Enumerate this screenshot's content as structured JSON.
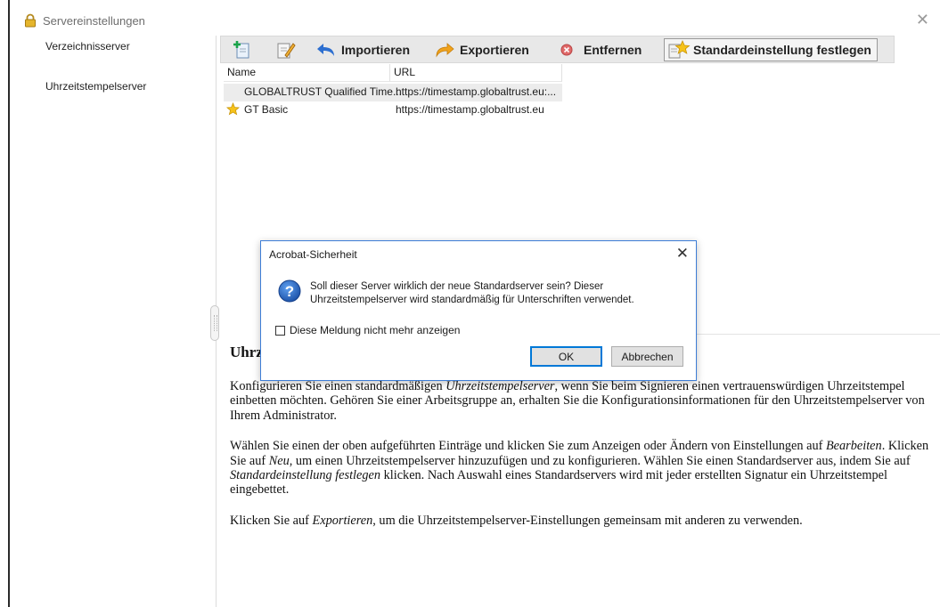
{
  "window": {
    "title": "Servereinstellungen",
    "lock_icon": "lock-icon",
    "close_icon": "close-icon"
  },
  "sidebar": {
    "items": [
      {
        "label": "Verzeichnisserver"
      },
      {
        "label": "Uhrzeitstempelserver"
      }
    ]
  },
  "toolbar": {
    "new_icon": "add-server-icon",
    "edit_icon": "edit-icon",
    "import_label": "Importieren",
    "export_label": "Exportieren",
    "remove_label": "Entfernen",
    "set_default_label": "Standardeinstellung festlegen"
  },
  "table": {
    "columns": [
      "Name",
      "URL"
    ],
    "rows": [
      {
        "name": "GLOBALTRUST Qualified Time...",
        "url": "https://timestamp.globaltrust.eu:...",
        "default": false,
        "selected": true
      },
      {
        "name": "GT Basic",
        "url": "https://timestamp.globaltrust.eu",
        "default": true,
        "selected": false
      }
    ]
  },
  "help": {
    "heading": "Uhrz",
    "p1_a": "Konfigurieren Sie einen standardmäßigen ",
    "p1_em": "Uhrzeitstempelserver",
    "p1_b": ", wenn Sie beim Signieren einen vertrauenswürdigen Uhrzeitstempel einbetten möchten. Gehören Sie einer Arbeitsgruppe an, erhalten Sie die Konfigurationsinformationen für den Uhrzeitstempelserver von Ihrem Administrator.",
    "p2_a": "Wählen Sie einen der oben aufgeführten Einträge und klicken Sie zum Anzeigen oder Ändern von Einstellungen auf ",
    "p2_em1": "Bearbeiten",
    "p2_b": ". Klicken Sie auf ",
    "p2_em2": "Neu",
    "p2_c": ", um einen Uhrzeitstempelserver hinzuzufügen und zu konfigurieren. Wählen Sie einen Standardserver aus, indem Sie auf ",
    "p2_em3": "Standardeinstellung festlegen",
    "p2_d": " klicken. Nach Auswahl eines Standardservers wird mit jeder erstellten Signatur ein Uhrzeitstempel eingebettet.",
    "p3_a": "Klicken Sie auf ",
    "p3_em": "Exportieren",
    "p3_b": ", um die Uhrzeitstempelserver-Einstellungen gemeinsam mit anderen zu verwenden."
  },
  "dialog": {
    "title": "Acrobat-Sicherheit",
    "message": "Soll dieser Server wirklich der neue Standardserver sein? Dieser Uhrzeitstempelserver wird standardmäßig für Unterschriften verwendet.",
    "checkbox_label": "Diese Meldung nicht mehr anzeigen",
    "checkbox_checked": false,
    "ok_label": "OK",
    "cancel_label": "Abbrechen",
    "icon": "question-icon"
  },
  "colors": {
    "accent": "#0078d7",
    "dialog_border": "#3d7dd6",
    "toolbar_bg": "#e8e8e8",
    "selected_row": "#ececec"
  }
}
